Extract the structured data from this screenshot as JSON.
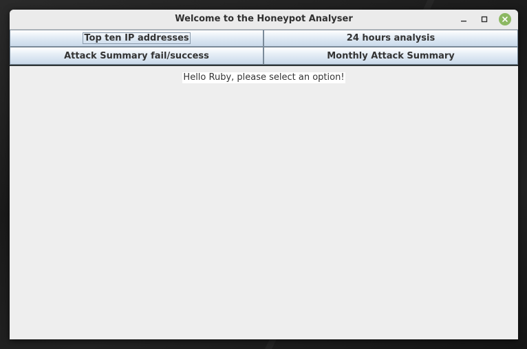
{
  "window": {
    "title": "Welcome to the Honeypot Analyser",
    "controls": {
      "minimize_icon": "minimize-icon",
      "maximize_icon": "maximize-icon",
      "close_icon": "close-icon",
      "close_color": "#8cb863"
    }
  },
  "menu": {
    "buttons": [
      {
        "label": "Top ten IP addresses",
        "focused": true
      },
      {
        "label": "24 hours analysis",
        "focused": false
      },
      {
        "label": "Attack Summary fail/success",
        "focused": false
      },
      {
        "label": "Monthly Attack Summary",
        "focused": false
      }
    ]
  },
  "content": {
    "greeting": "Hello Ruby, please select an option!"
  }
}
